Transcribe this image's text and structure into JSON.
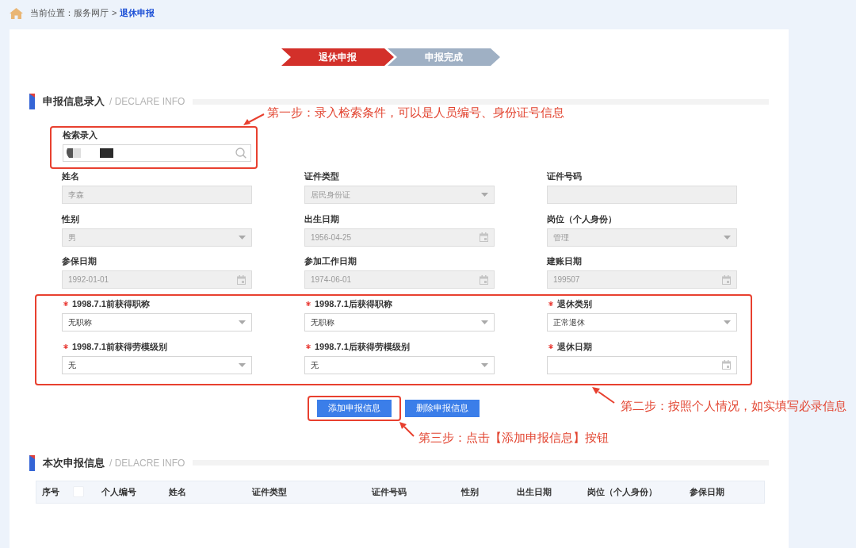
{
  "breadcrumb": {
    "label": "当前位置：",
    "separator": ">",
    "items": [
      {
        "text": "服务网厅",
        "selected": false
      },
      {
        "text": "退休申报",
        "selected": true
      }
    ]
  },
  "steps": [
    {
      "label": "退休申报",
      "selected": true
    },
    {
      "label": "申报完成",
      "selected": false
    }
  ],
  "entry_section": {
    "title": "申报信息录入",
    "subtitle": "/ DECLARE INFO"
  },
  "search": {
    "label": "检索录入",
    "highlighted": true
  },
  "fields": [
    {
      "label": "姓名",
      "kind": "text",
      "value": "李森",
      "disabled": true,
      "required": false
    },
    {
      "label": "证件类型",
      "kind": "select",
      "value": "居民身份证",
      "disabled": true,
      "required": false
    },
    {
      "label": "证件号码",
      "kind": "text",
      "disabled": true,
      "required": false
    },
    {
      "label": "性别",
      "kind": "select",
      "value": "男",
      "disabled": true,
      "required": false
    },
    {
      "label": "出生日期",
      "kind": "date",
      "value": "1956-04-25",
      "disabled": true,
      "required": false
    },
    {
      "label": "岗位（个人身份）",
      "kind": "select",
      "value": "管理",
      "disabled": true,
      "required": false
    },
    {
      "label": "参保日期",
      "kind": "date",
      "value": "1992-01-01",
      "disabled": true,
      "required": false
    },
    {
      "label": "参加工作日期",
      "kind": "date",
      "value": "1974-06-01",
      "disabled": true,
      "required": false
    },
    {
      "label": "建账日期",
      "kind": "date",
      "value": "199507",
      "disabled": true,
      "required": false
    }
  ],
  "required_group": {
    "highlighted": true,
    "fields": [
      {
        "label": "1998.7.1前获得职称",
        "kind": "select",
        "value": "无职称",
        "disabled": false,
        "required": true
      },
      {
        "label": "1998.7.1后获得职称",
        "kind": "select",
        "value": "无职称",
        "disabled": false,
        "required": true
      },
      {
        "label": "退休类别",
        "kind": "select",
        "value": "正常退休",
        "disabled": false,
        "required": true
      },
      {
        "label": "1998.7.1前获得劳模级别",
        "kind": "select",
        "value": "无",
        "disabled": false,
        "required": true
      },
      {
        "label": "1998.7.1后获得劳模级别",
        "kind": "select",
        "value": "无",
        "disabled": false,
        "required": true
      },
      {
        "label": "退休日期",
        "kind": "date",
        "disabled": false,
        "required": true
      }
    ]
  },
  "buttons": [
    {
      "label": "添加申报信息",
      "highlighted": true
    },
    {
      "label": "删除申报信息",
      "highlighted": false
    }
  ],
  "annotations": [
    {
      "text": "第一步：录入检索条件，可以是人员编号、身份证号信息"
    },
    {
      "text": "第二步：按照个人情况，如实填写必录信息"
    },
    {
      "text": "第三步：点击【添加申报信息】按钮"
    }
  ],
  "declared_section": {
    "title": "本次申报信息",
    "subtitle": "/ DELACRE INFO"
  },
  "table": {
    "columns": [
      {
        "kind": "text",
        "label": "序号"
      },
      {
        "kind": "checkbox",
        "checked": false
      },
      {
        "kind": "text",
        "label": "个人编号"
      },
      {
        "kind": "text",
        "label": "姓名"
      },
      {
        "kind": "text",
        "label": "证件类型"
      },
      {
        "kind": "text",
        "label": "证件号码"
      },
      {
        "kind": "text",
        "label": "性别"
      },
      {
        "kind": "text",
        "label": "出生日期"
      },
      {
        "kind": "text",
        "label": "岗位（个人身份）"
      },
      {
        "kind": "text",
        "label": "参保日期"
      }
    ]
  }
}
